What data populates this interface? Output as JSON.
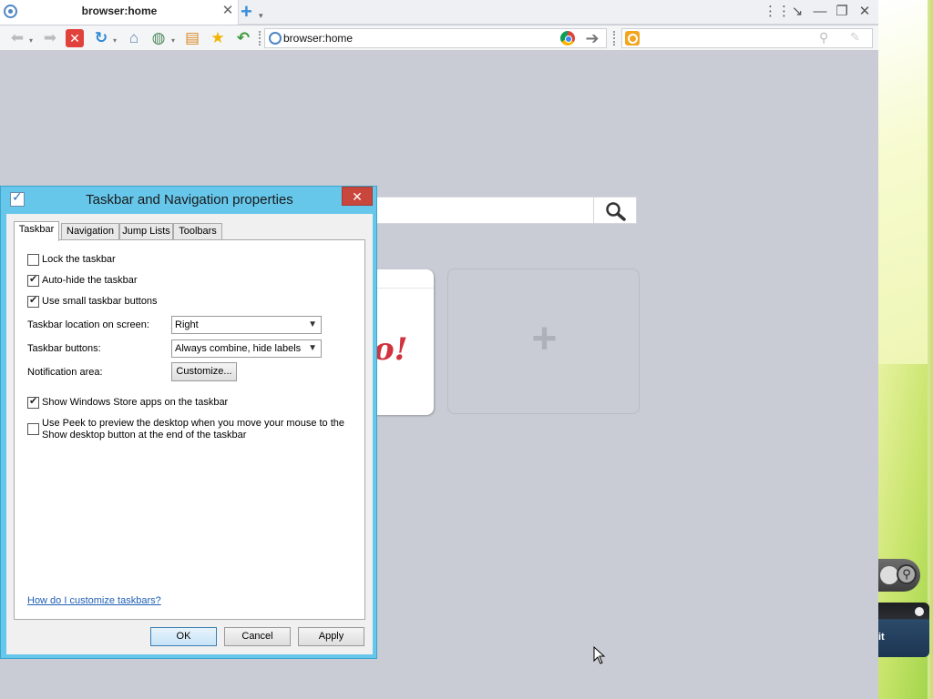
{
  "browser": {
    "tab_title": "browser:home",
    "tab_close": "✕",
    "new_tab": "+",
    "address": "browser:home",
    "window_controls": [
      "⋮⋮",
      "↘",
      "—",
      "❐",
      "✕"
    ]
  },
  "toolbar_icons": [
    "back-icon",
    "forward-icon",
    "stop-icon",
    "reload-icon",
    "home-icon",
    "rss-icon",
    "bookmarks-icon",
    "favorite-star-icon",
    "undo-icon"
  ],
  "page": {
    "tile_logo": "o!",
    "add_tile": "+"
  },
  "dialog": {
    "title": "Taskbar and Navigation properties",
    "close": "✕",
    "tabs": [
      {
        "label": "Taskbar",
        "active": true
      },
      {
        "label": "Navigation",
        "active": false
      },
      {
        "label": "Jump Lists",
        "active": false
      },
      {
        "label": "Toolbars",
        "active": false
      }
    ],
    "options": {
      "lock": {
        "label": "Lock the taskbar",
        "checked": false
      },
      "autohide": {
        "label": "Auto-hide the taskbar",
        "checked": true
      },
      "small": {
        "label": "Use small taskbar buttons",
        "checked": true
      },
      "store": {
        "label": "Show Windows Store apps on the taskbar",
        "checked": true
      },
      "peek": {
        "label_line1": "Use Peek to preview the desktop when you move your mouse to the",
        "label_line2": "Show desktop button at the end of the taskbar",
        "checked": false
      }
    },
    "location": {
      "label": "Taskbar location on screen:",
      "value": "Right"
    },
    "buttons": {
      "label": "Taskbar buttons:",
      "value": "Always combine, hide labels"
    },
    "notification": {
      "label": "Notification area:",
      "button": "Customize..."
    },
    "help_link": "How do I customize taskbars?",
    "ok": "OK",
    "cancel": "Cancel",
    "apply": "Apply"
  },
  "gadget": {
    "panel_text": "it"
  },
  "colors": {
    "dialog_frame": "#66c7eb",
    "close_red": "#c9463d",
    "link_blue": "#1f5fb5"
  }
}
